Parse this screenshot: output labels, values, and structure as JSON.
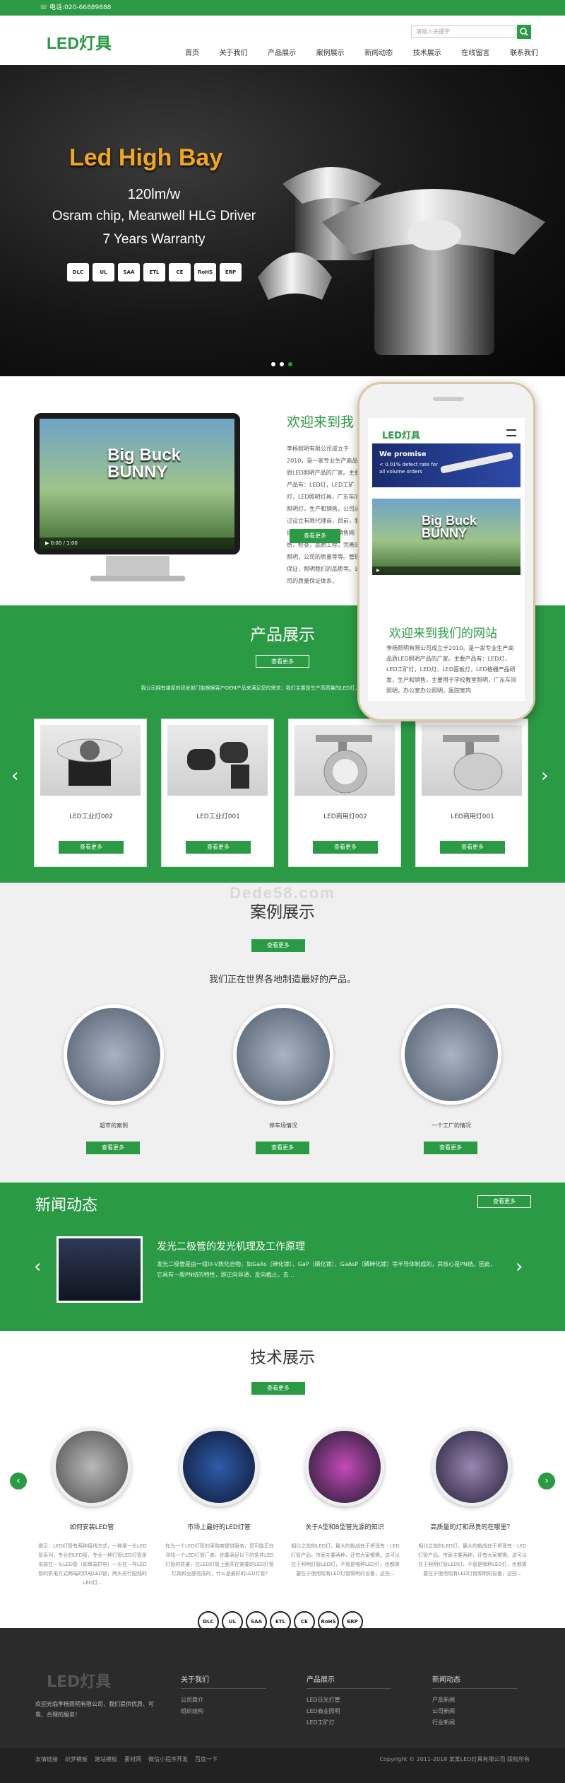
{
  "topbar": {
    "phone": "电话:020-66889888"
  },
  "header": {
    "logo": "LED灯具",
    "search_placeholder": "请输入关键字"
  },
  "nav": [
    "首页",
    "关于我们",
    "产品展示",
    "案例展示",
    "新闻动态",
    "技术展示",
    "在线留言",
    "联系我们"
  ],
  "banner": {
    "title": "Led High Bay",
    "line1": "120lm/w",
    "line2": "Osram chip, Meanwell HLG Driver",
    "line3": "7 Years Warranty",
    "certs": [
      "DLC",
      "UL",
      "SAA",
      "ETL",
      "CE",
      "RoHS",
      "ERP"
    ],
    "slide_count": 3,
    "active_slide": 3
  },
  "welcome": {
    "title": "欢迎来到我",
    "text": "李杨照明有限公司成立于2010，是一家专业生产高品质LED照明产品的厂家。主要产品有：LED灯，LED工矿灯，LED照明灯具，广东车间照明灯，生产和销售，公司通过设立有限代理商，目前，我们已经建立了完善的销售网络，检查，品质工程，完善的照明，公司的质量等等。管理保证，照明我们的品质等。公司的质量保证体系，",
    "button": "查看更多",
    "video_title": "Big Buck BUNNY",
    "player_time": "0:00 / 1:00"
  },
  "phone": {
    "logo": "LED灯具",
    "promo1": "We promise",
    "promo2": "< 0.01% defect rate for",
    "promo3": "all volume orders",
    "title": "欢迎来到我们的网站",
    "text": "李杨照明有限公司成立于2010。是一家专业生产高品质LED照明产品的厂家。主要产品有：LED灯，LED工矿灯，LED灯、LED面板灯，LED格栅产品研发，生产和销售，主要用于学校教室照明，广东车间照明，办公室办公照明，医院室内"
  },
  "products": {
    "title": "产品展示",
    "more": "查看更多",
    "desc": "我公司拥有雄厚的研发部门能根据客户OEM产品来满足您的需求；我们主要是生产高质量的LED灯，使您打开市场，更加巨大需求",
    "items": [
      {
        "name": "LED工业灯002",
        "button": "查看更多"
      },
      {
        "name": "LED工业灯001",
        "button": "查看更多"
      },
      {
        "name": "LED商用灯002",
        "button": "查看更多"
      },
      {
        "name": "LED商用灯001",
        "button": "查看更多"
      }
    ]
  },
  "cases": {
    "title": "案例展示",
    "more": "查看更多",
    "subtitle": "我们正在世界各地制造最好的产品。",
    "watermark": "Dede58.com",
    "items": [
      {
        "label": "超市的案例",
        "button": "查看更多"
      },
      {
        "label": "停车场情况",
        "button": "查看更多"
      },
      {
        "label": "一个工厂的情况",
        "button": "查看更多"
      }
    ]
  },
  "news": {
    "title": "新闻动态",
    "more": "查看更多",
    "headline": "发光二极管的发光机理及工作原理",
    "text": "发光二极管是由一组III-V族化合物，如GaAs（砷化镓）、GaP（磷化镓）、GaAsP（磷砷化镓）等半导体制成的，其核心是PN结。因此，它具有一般PN结的特性，即正向导通，反向截止，击…"
  },
  "tech": {
    "title": "技术展示",
    "more": "查看更多",
    "items": [
      {
        "label": "如何安装LED管",
        "text": "提示：LED灯管有两种接线方式，一种是一头LED管系列，专业的LED管，专业一种灯管LED灯管是安装在一头LED管（即单端供电）一头在一样LED管的供电方式两端的供电LED管，两头进行配线的LED灯..."
      },
      {
        "label": "市场上最好的LED灯管",
        "text": "在为一个LED灯管的采购商提供服务，您可能正在寻找一个LED灯管厂商，你要满足以下的条件LED灯管的质量，在LED灯管上面并在需要的LED灯管灯具和全部完成的，什么是最好的LED灯管?"
      },
      {
        "label": "关于A型和B型管光源的知识",
        "text": "相比之前的LED灯，最大的挑战在于将现有 - LED灯管产品，市面主要两种，还有大家都需。这可以在于照明灯管LED灯，不管是哪种LED灯，也都需要在于使用现有LED灯管照明的设备，这些..."
      },
      {
        "label": "高质量的灯和昂贵的在哪里？",
        "text": "相比之前的LED灯，最大的挑战在于将现有 - LED灯管产品，市面主要两种，还有大家都需。这可以在于照明灯管LED灯，不管是哪种LED灯，也都需要在于使用现有LED灯管照明的设备，这些..."
      }
    ]
  },
  "footer_certs": [
    "DLC",
    "UL",
    "SAA",
    "ETL",
    "CE",
    "RoHS",
    "ERP"
  ],
  "footer": {
    "logo": "LED灯具",
    "desc": "欢迎光临李杨照明有限公司，我们提供优质、可靠、合理的服务！",
    "cols": [
      {
        "head": "关于我们",
        "items": [
          "公司简介",
          "组织结构"
        ]
      },
      {
        "head": "产品展示",
        "items": [
          "LED日光灯管",
          "LED商业照明",
          "LED工矿灯"
        ]
      },
      {
        "head": "新闻动态",
        "items": [
          "产品新闻",
          "公司新闻",
          "行业新闻"
        ]
      }
    ]
  },
  "bottom": {
    "links": [
      "友情链接",
      "织梦模板",
      "建站模板",
      "素材网",
      "微信小程序开发",
      "百度一下"
    ],
    "copy": "Copyright © 2011-2018 某某LED灯具有限公司 版权所有"
  },
  "colors": {
    "brand": "#2a9a44",
    "dark": "#2b2b2b",
    "banner_title": "#f2a720"
  }
}
